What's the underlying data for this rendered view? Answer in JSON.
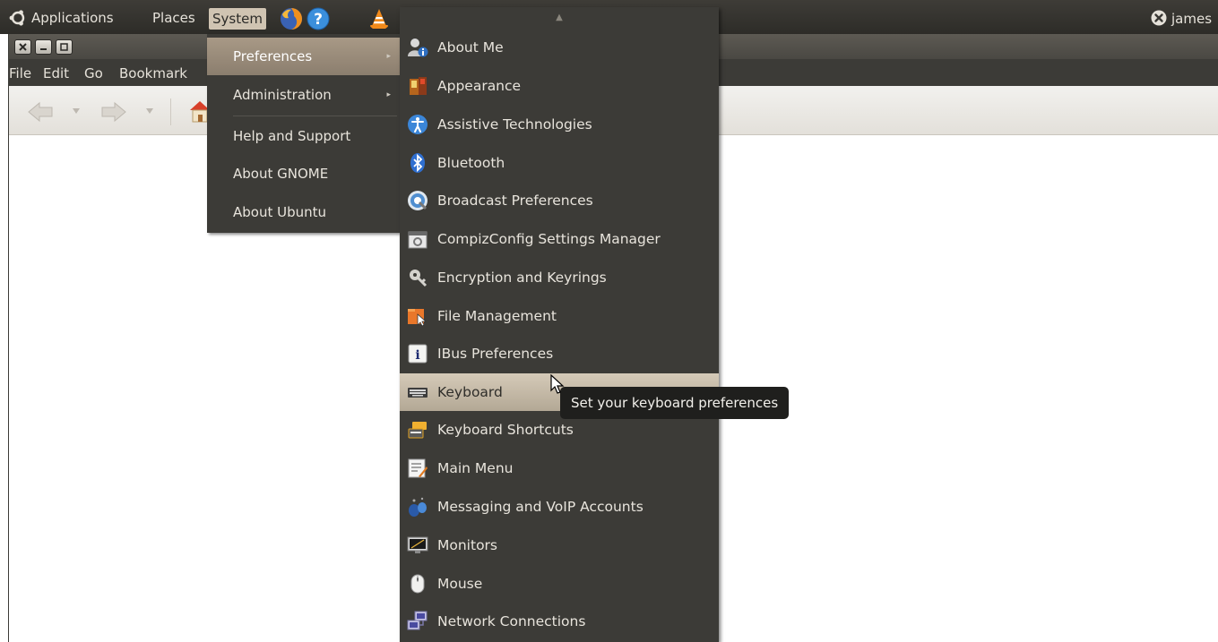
{
  "top_panel": {
    "menus": [
      "Applications",
      "Places",
      "System"
    ],
    "launchers": [
      "firefox-icon",
      "help-icon",
      "vlc-icon"
    ],
    "user": "james"
  },
  "window": {
    "menubar": [
      "File",
      "Edit",
      "Go",
      "Bookmark"
    ],
    "toolbar": [
      "back-arrow-icon",
      "forward-arrow-icon",
      "home-icon"
    ]
  },
  "system_menu": {
    "items": [
      {
        "label": "Preferences",
        "submenu": true,
        "active": true
      },
      {
        "label": "Administration",
        "submenu": true
      },
      {
        "label": "Help and Support"
      },
      {
        "label": "About GNOME"
      },
      {
        "label": "About Ubuntu"
      }
    ]
  },
  "preferences_menu": {
    "items": [
      {
        "label": "About Me",
        "icon": "about-me-icon"
      },
      {
        "label": "Appearance",
        "icon": "appearance-icon"
      },
      {
        "label": "Assistive Technologies",
        "icon": "accessibility-icon"
      },
      {
        "label": "Bluetooth",
        "icon": "bluetooth-icon"
      },
      {
        "label": "Broadcast Preferences",
        "icon": "broadcast-icon"
      },
      {
        "label": "CompizConfig Settings Manager",
        "icon": "compizconfig-icon"
      },
      {
        "label": "Encryption and Keyrings",
        "icon": "keyring-icon"
      },
      {
        "label": "File Management",
        "icon": "file-management-icon"
      },
      {
        "label": "IBus Preferences",
        "icon": "ibus-icon"
      },
      {
        "label": "Keyboard",
        "icon": "keyboard-icon",
        "active": true
      },
      {
        "label": "Keyboard Shortcuts",
        "icon": "keyboard-shortcuts-icon"
      },
      {
        "label": "Main Menu",
        "icon": "main-menu-icon"
      },
      {
        "label": "Messaging and VoIP Accounts",
        "icon": "messaging-icon"
      },
      {
        "label": "Monitors",
        "icon": "monitor-icon"
      },
      {
        "label": "Mouse",
        "icon": "mouse-icon"
      },
      {
        "label": "Network Connections",
        "icon": "network-icon"
      }
    ]
  },
  "tooltip": "Set your keyboard preferences"
}
